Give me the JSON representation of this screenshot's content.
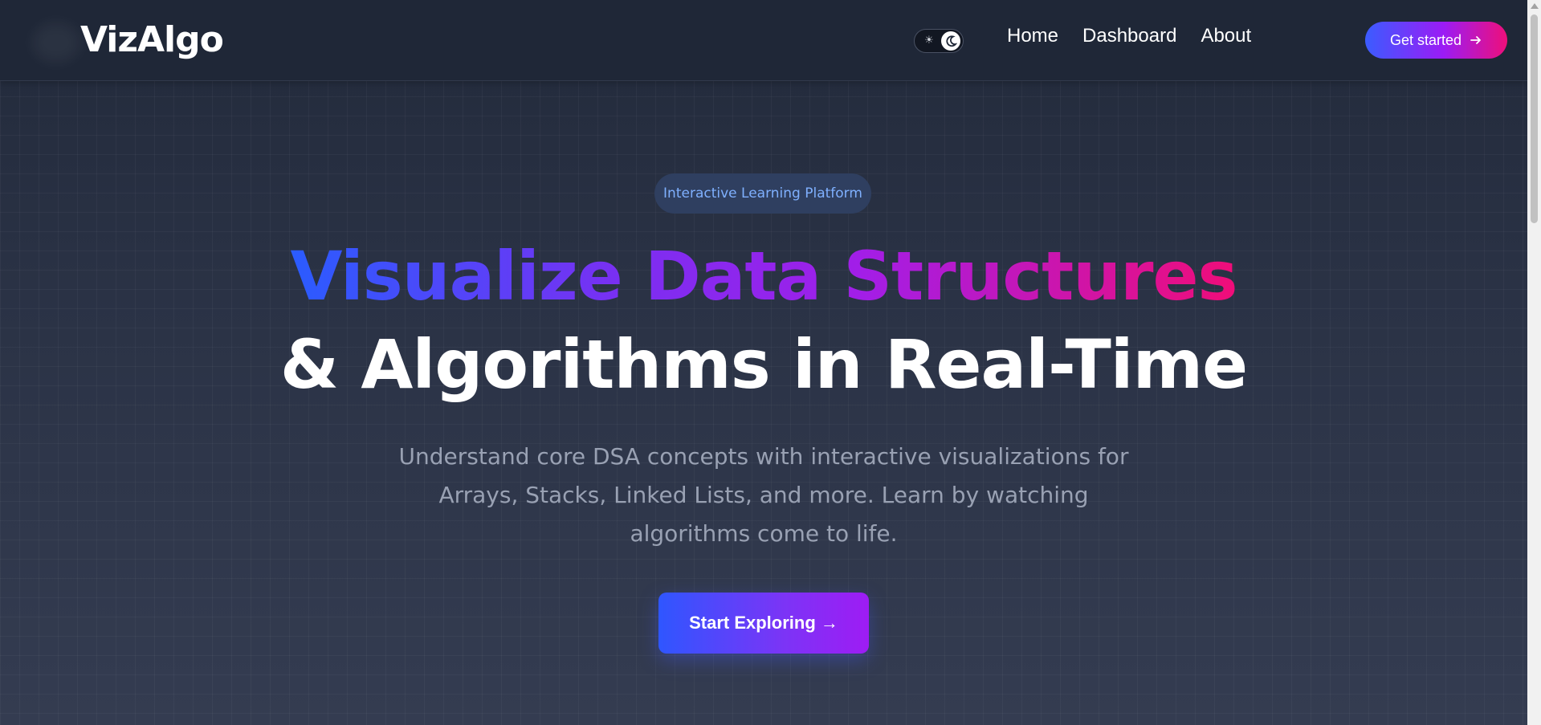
{
  "header": {
    "logo": "VizAlgo",
    "nav": [
      "Home",
      "Dashboard",
      "About"
    ],
    "cta_label": "Get started",
    "cta_icon": "arrow-right-icon",
    "theme_toggle": {
      "light_icon": "sun-icon",
      "dark_icon": "moon-icon",
      "mode": "dark"
    }
  },
  "hero": {
    "badge": "Interactive Learning Platform",
    "title_line1": "Visualize Data Structures",
    "title_line2": "& Algorithms in Real-Time",
    "subtitle": "Understand core DSA concepts with interactive visualizations for Arrays, Stacks, Linked Lists, and more. Learn by watching algorithms come to life.",
    "cta_label": "Start Exploring →"
  },
  "colors": {
    "gradient_start": "#2a5cff",
    "gradient_mid": "#a21ee8",
    "gradient_end": "#f00d78",
    "badge_text": "#7fb0ff",
    "background": "#2a3245"
  }
}
